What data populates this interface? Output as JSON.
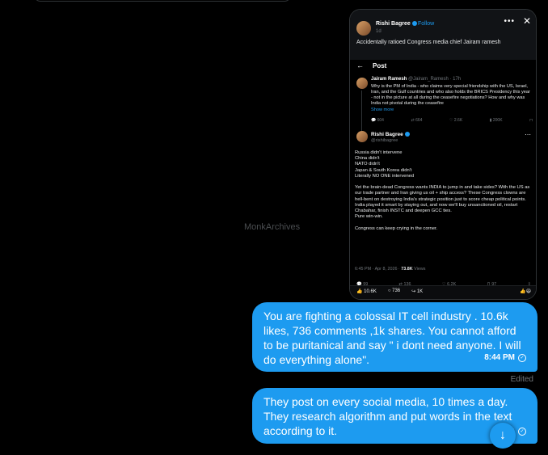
{
  "watermark": "MonkArchives",
  "screenshot": {
    "author_name": "Rishi Bagree",
    "follow_label": "Follow",
    "meta": "1d",
    "caption": "Accidentally ratioed Congress media chief Jairam ramesh",
    "post_title": "Post",
    "quoted": {
      "name": "Jairam Ramesh",
      "handle": "@Jairam_Ramesh · 17h",
      "text": "Why is the PM of India - who claims very special friendship with the US, Israel, Iran, and the Gulf countries and who also holds the BRICS Presidency this year - not in the picture at all during the ceasefire negotiations? How and why was India not pivotal during the ceasefire",
      "show_more": "Show more",
      "actions": [
        "604",
        "664",
        "2.6K",
        "200K"
      ]
    },
    "reply": {
      "name": "Rishi Bagree",
      "handle": "@rishibagree",
      "body": "Russia didn't intervene\nChina didn't\nNATO didn't\nJapan & South Korea didn't\nLiterally NO ONE intervened\n\nYet the brain-dead Congress wants INDIA to jump in and take sides? With the US as our trade partner and Iran giving us oil + ship access? These Congress clowns are hell-bent on destroying India's strategic position just to score cheap political points. India played it smart by staying out, and now we'll buy unsanctioned oil, restart Chabahar, finish INSTC and deepen GCC ties.\nPure win-win.\n\nCongress can keep crying in the corner.",
      "stamp_time": "6:45 PM · Apr 8, 2026 · ",
      "stamp_views": "73.8K",
      "stamp_views_label": " Views",
      "actions": [
        "99",
        "136",
        "6.2K",
        "97"
      ]
    },
    "footer": {
      "likes": "10.6K",
      "comments": "736",
      "shares": "1K"
    }
  },
  "messages": [
    {
      "text": "You are fighting a colossal IT cell industry . 10.6k likes, 736 comments ,1k shares. You cannot afford to be puritanical and say \" i dont need anyone. I will do everything alone\".",
      "time": "8:44 PM"
    },
    {
      "text": "They post on every social media, 10 times a day. They research algorithm and put words in the text according to it.",
      "time": "8:"
    }
  ],
  "edited_label": "Edited",
  "colors": {
    "accent": "#1d9bf0",
    "background": "#000000"
  }
}
